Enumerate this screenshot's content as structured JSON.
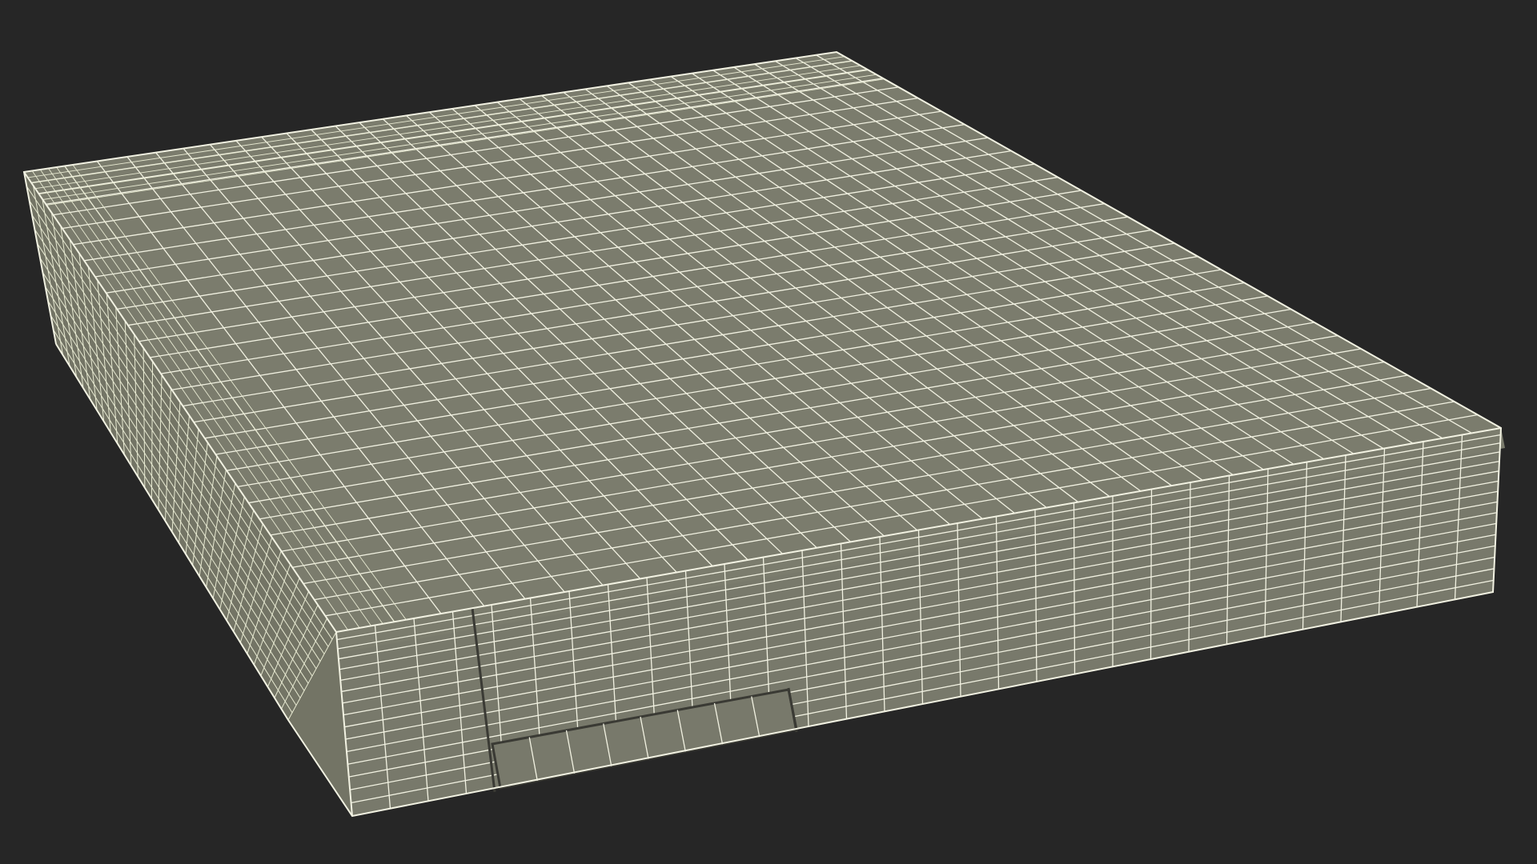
{
  "scene": {
    "subject": "wireframe-mesh-render",
    "colors": {
      "background": "#262626",
      "surface_top": "#7b7c6d",
      "surface_front": "#78796b",
      "surface_side": "#737465",
      "wire": "#f2f2e2",
      "wire_dense": "#e8ead2",
      "seam": "#3a3a34"
    },
    "mesh": {
      "top_columns": 34,
      "top_rows": 30,
      "front_columns": 30,
      "front_rows": 16,
      "side_rows": 34,
      "side_columns": 12
    }
  }
}
